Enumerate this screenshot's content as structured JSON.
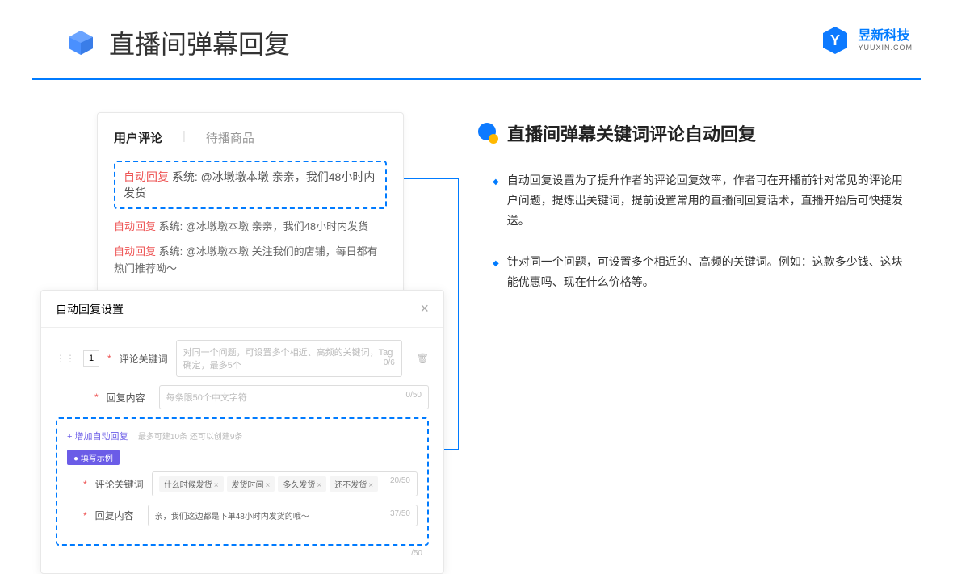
{
  "header": {
    "title": "直播间弹幕回复"
  },
  "brand": {
    "cn": "昱新科技",
    "en": "YUUXIN.COM"
  },
  "card1": {
    "tab1": "用户评论",
    "tab2": "待播商品",
    "highlight": {
      "label": "自动回复",
      "text": " 系统: @冰墩墩本墩 亲亲，我们48小时内发货"
    },
    "line2": {
      "label": "自动回复",
      "text": " 系统: @冰墩墩本墩 亲亲，我们48小时内发货"
    },
    "line3": {
      "label": "自动回复",
      "text": " 系统: @冰墩墩本墩 关注我们的店铺，每日都有热门推荐呦～"
    }
  },
  "card2": {
    "title": "自动回复设置",
    "num": "1",
    "row1_label": "评论关键词",
    "row1_placeholder": "对同一个问题，可设置多个相近、高频的关键词，Tag确定，最多5个",
    "row1_count": "0/6",
    "row2_label": "回复内容",
    "row2_placeholder": "每条限50个中文字符",
    "row2_count": "0/50",
    "add_link": "+ 增加自动回复",
    "add_hint": "最多可建10条 还可以创建9条",
    "example_badge": "● 填写示例",
    "ex_row1_label": "评论关键词",
    "ex_tags": [
      "什么时候发货",
      "发货时间",
      "多久发货",
      "还不发货"
    ],
    "ex_row1_count": "20/50",
    "ex_row2_label": "回复内容",
    "ex_row2_text": "亲，我们这边都是下单48小时内发货的哦～",
    "ex_row2_count": "37/50",
    "outer_count": "/50"
  },
  "right": {
    "title": "直播间弹幕关键词评论自动回复",
    "b1": "自动回复设置为了提升作者的评论回复效率，作者可在开播前针对常见的评论用户问题，提炼出关键词，提前设置常用的直播间回复话术，直播开始后可快捷发送。",
    "b2": "针对同一个问题，可设置多个相近的、高频的关键词。例如：这款多少钱、这块能优惠吗、现在什么价格等。"
  }
}
